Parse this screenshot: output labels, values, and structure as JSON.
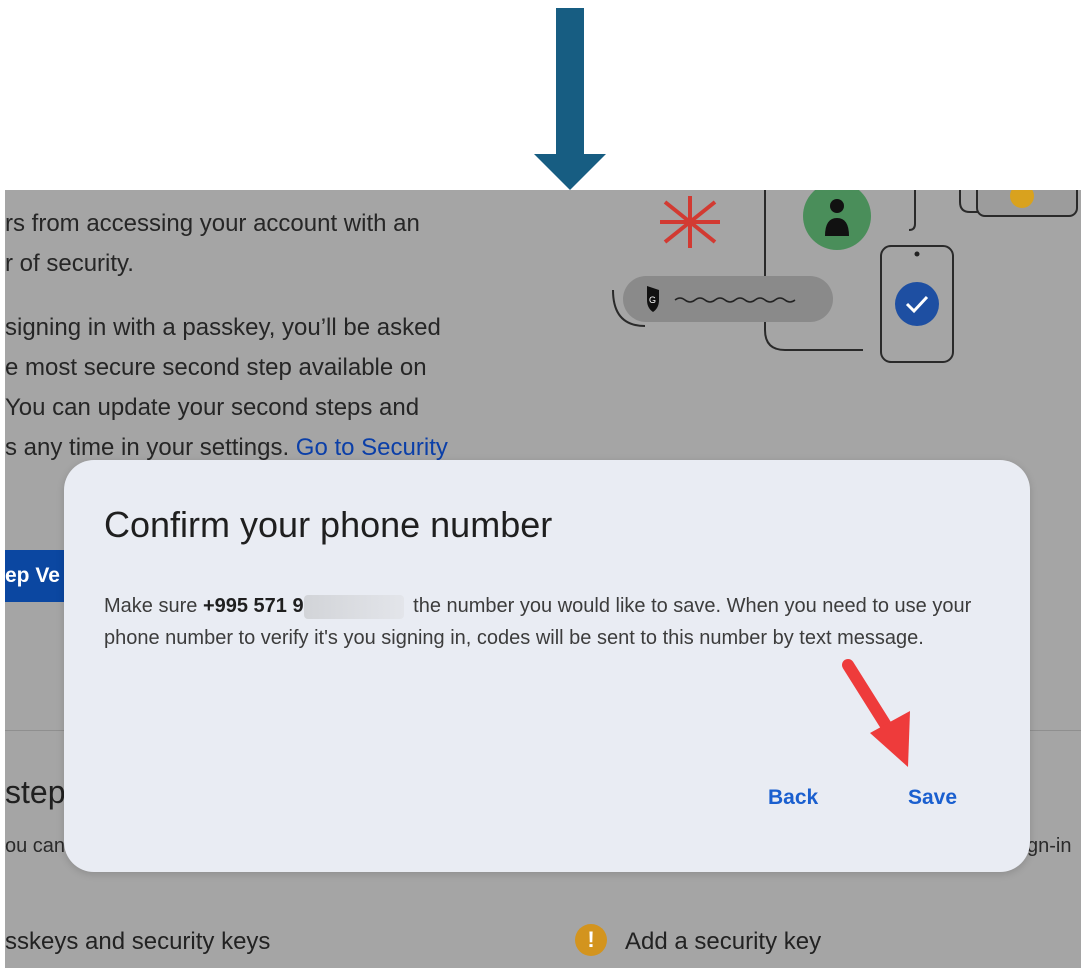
{
  "background": {
    "para1": [
      "rs from accessing your account with an",
      "r of security."
    ],
    "para2": [
      "signing in with a passkey, you’ll be asked",
      "e most secure second step available on",
      "You can update your second steps and"
    ],
    "para2_last_prefix": "s any time in your settings.",
    "para2_link": "Go to Security",
    "button_label": "ep Ve",
    "heading": "step",
    "sub_left": "ou can",
    "sub_right": "gn-in",
    "passkeys_row": "sskeys and security keys",
    "add_key_row": "Add a security key",
    "warning_glyph": "!"
  },
  "dialog": {
    "title": "Confirm your phone number",
    "body_prefix": "Make sure",
    "phone_visible": "+995 571 9",
    "body_suffix": "the number you would like to save. When you need to use your phone number to verify it's you signing in, codes will be sent to this number by text message.",
    "back_label": "Back",
    "save_label": "Save"
  },
  "colors": {
    "arrow": "#175d82",
    "dialog_bg": "#e9ecf3",
    "button_text": "#1a5fcf",
    "annotation_arrow": "#ee3b3b"
  }
}
